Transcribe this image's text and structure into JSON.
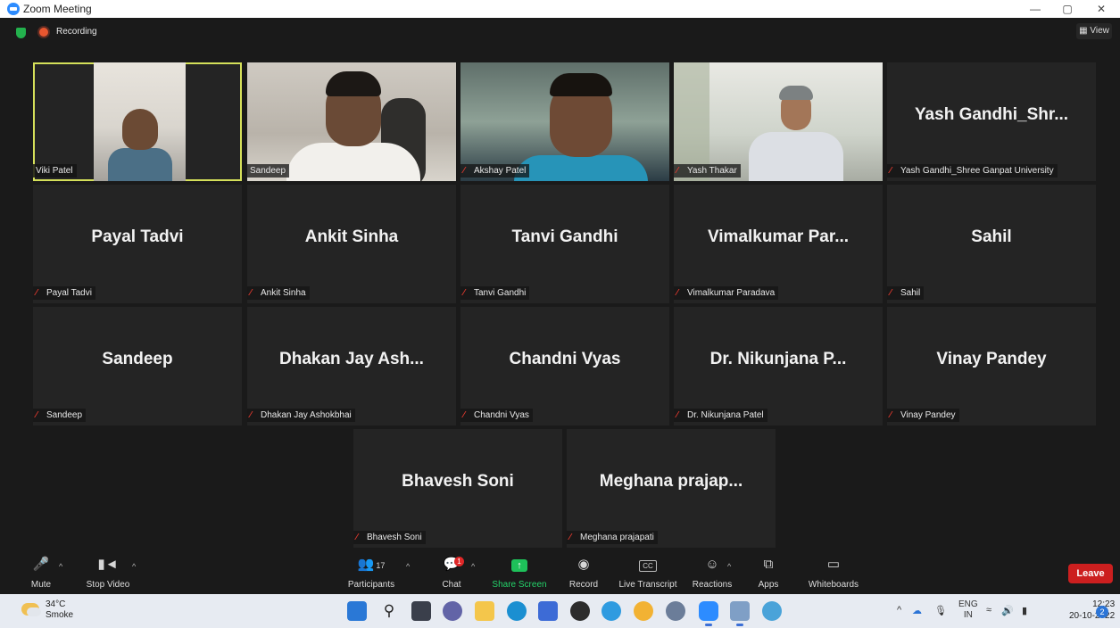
{
  "window": {
    "title": "Zoom Meeting",
    "controls": [
      "—",
      "▢",
      "✕"
    ]
  },
  "meeting_bar": {
    "recording_label": "Recording",
    "view_label": "View"
  },
  "tiles": [
    {
      "big": "",
      "name": "Viki Patel"
    },
    {
      "big": "",
      "name": "Sandeep"
    },
    {
      "big": "",
      "name": "Akshay Patel"
    },
    {
      "big": "",
      "name": "Yash Thakar"
    },
    {
      "big": "Yash Gandhi_Shr...",
      "name": "Yash Gandhi_Shree Ganpat University"
    },
    {
      "big": "Payal Tadvi",
      "name": "Payal Tadvi"
    },
    {
      "big": "Ankit Sinha",
      "name": "Ankit Sinha"
    },
    {
      "big": "Tanvi Gandhi",
      "name": "Tanvi Gandhi"
    },
    {
      "big": "Vimalkumar Par...",
      "name": "Vimalkumar Paradava"
    },
    {
      "big": "Sahil",
      "name": "Sahil"
    },
    {
      "big": "Sandeep",
      "name": "Sandeep"
    },
    {
      "big": "Dhakan Jay Ash...",
      "name": "Dhakan Jay Ashokbhai"
    },
    {
      "big": "Chandni Vyas",
      "name": "Chandni Vyas"
    },
    {
      "big": "Dr. Nikunjana P...",
      "name": "Dr. Nikunjana Patel"
    },
    {
      "big": "Vinay Pandey",
      "name": "Vinay Pandey"
    },
    {
      "big": "Bhavesh Soni",
      "name": "Bhavesh Soni"
    },
    {
      "big": "Meghana prajap...",
      "name": "Meghana prajapati"
    }
  ],
  "toolbar": {
    "mute": "Mute",
    "stop_video": "Stop Video",
    "participants": "Participants",
    "participant_count": "17",
    "chat": "Chat",
    "chat_badge": "1",
    "share_screen": "Share Screen",
    "record": "Record",
    "live_transcript": "Live Transcript",
    "cc": "CC",
    "reactions": "Reactions",
    "apps": "Apps",
    "whiteboards": "Whiteboards",
    "leave": "Leave"
  },
  "taskbar": {
    "temperature": "34°C",
    "weather": "Smoke",
    "lang": "ENG",
    "region": "IN",
    "time": "12:23",
    "date": "20-10-2022",
    "notifications": "2"
  },
  "colors": {
    "active_speaker_border": "#d5e05a",
    "share_green": "#1ec15a",
    "leave_red": "#cc1f1f",
    "muted_red": "#e23a2f"
  }
}
